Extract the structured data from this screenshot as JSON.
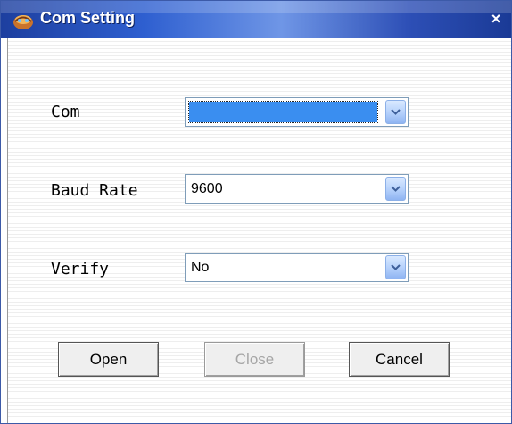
{
  "window": {
    "title": "Com Setting",
    "close_glyph": "×",
    "icon": "app-icon"
  },
  "form": {
    "com": {
      "label": "Com",
      "value": ""
    },
    "baud_rate": {
      "label": "Baud Rate",
      "value": "9600"
    },
    "verify": {
      "label": "Verify",
      "value": "No"
    }
  },
  "buttons": {
    "open": "Open",
    "close": "Close",
    "cancel": "Cancel"
  },
  "colors": {
    "titlebar": "#2e5fd0",
    "selection": "#3a8ef0"
  }
}
